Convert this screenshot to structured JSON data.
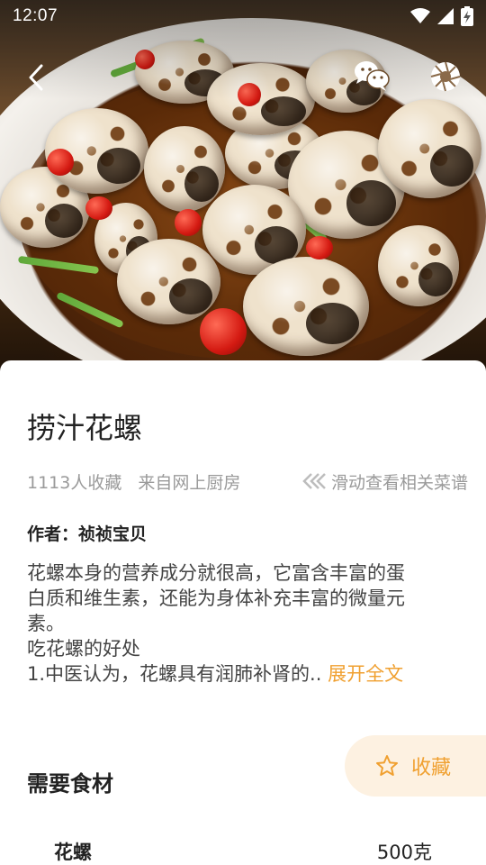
{
  "status_bar": {
    "time": "12:07"
  },
  "recipe": {
    "title": "捞汁花螺",
    "favorites": "1113人收藏",
    "source": "来自网上厨房",
    "swipe_hint": "滑动查看相关菜谱",
    "author_label": "作者：",
    "author_name": "祯祯宝贝",
    "description_lines": [
      "花螺本身的营养成分就很高，它富含丰富的蛋",
      "白质和维生素，还能为身体补充丰富的微量元",
      "素。",
      "吃花螺的好处",
      "1.中医认为，花螺具有润肺补肾的.."
    ],
    "expand_label": "展开全文"
  },
  "ingredients_section": {
    "title": "需要食材",
    "items": [
      {
        "name": "花螺",
        "amount": "500克"
      }
    ]
  },
  "favorite_button": {
    "label": "收藏"
  },
  "icons": {
    "back": "back-chevron-icon",
    "share": "wechat-icon",
    "camera": "camera-aperture-icon",
    "favorite": "star-outline-icon",
    "swipe": "double-chevron-left-icon"
  },
  "colors": {
    "accent": "#f0a030",
    "accent_bg": "#fdf1e1",
    "muted_text": "#9a9a9a"
  }
}
